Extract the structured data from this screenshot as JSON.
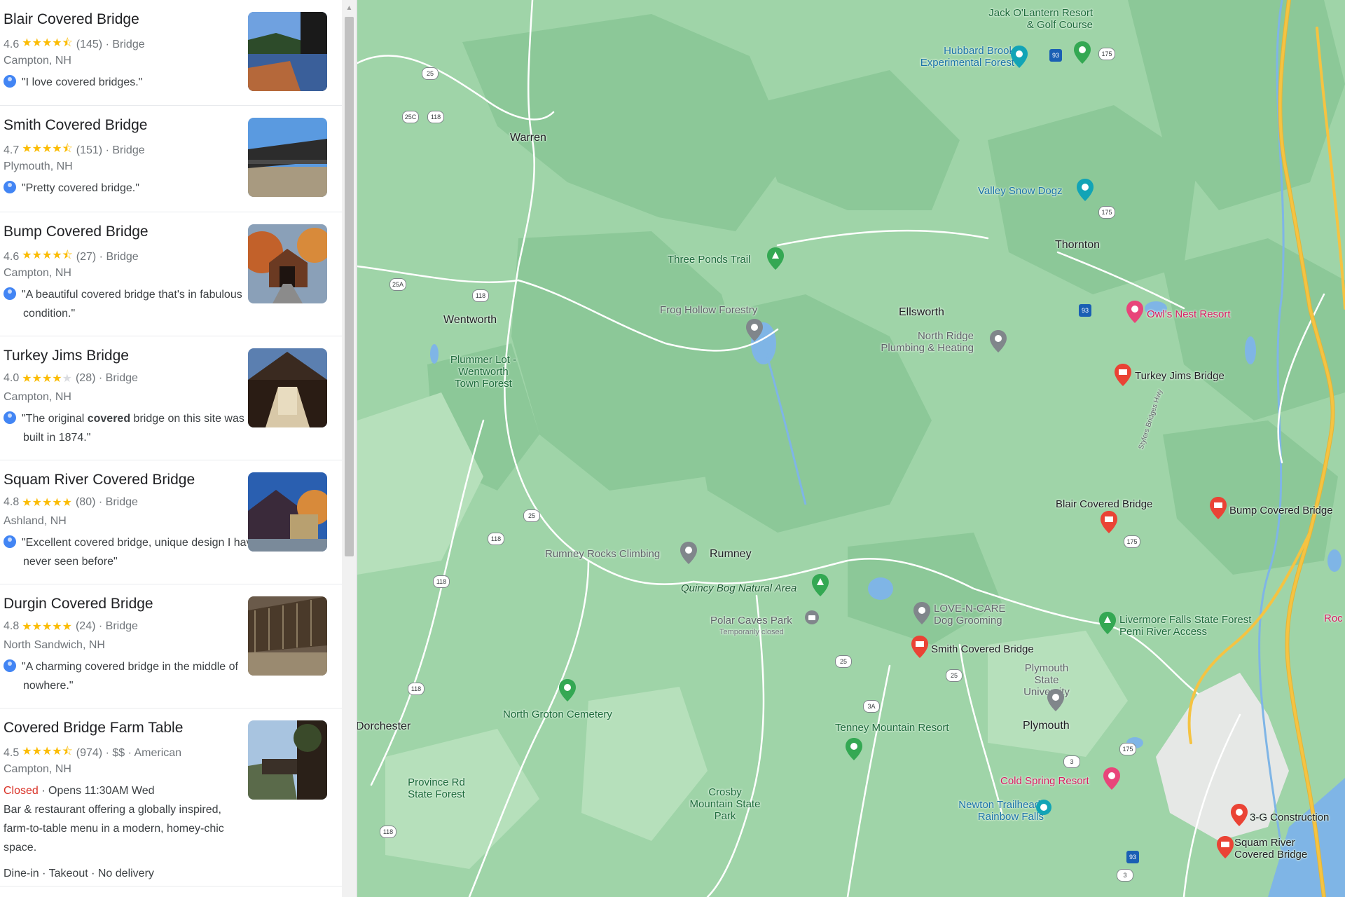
{
  "results": [
    {
      "title": "Blair Covered Bridge",
      "rating": "4.6",
      "stars": 4.5,
      "count": "(145)",
      "type": "Bridge",
      "address": "Campton, NH",
      "review": "\"I love covered bridges.\""
    },
    {
      "title": "Smith Covered Bridge",
      "rating": "4.7",
      "stars": 4.5,
      "count": "(151)",
      "type": "Bridge",
      "address": "Plymouth, NH",
      "review": "\"Pretty covered bridge.\""
    },
    {
      "title": "Bump Covered Bridge",
      "rating": "4.6",
      "stars": 4.5,
      "count": "(27)",
      "type": "Bridge",
      "address": "Campton, NH",
      "review": "\"A beautiful covered bridge that's in fabulous condition.\""
    },
    {
      "title": "Turkey Jims Bridge",
      "rating": "4.0",
      "stars": 4,
      "count": "(28)",
      "type": "Bridge",
      "address": "Campton, NH",
      "review_pre": "\"The original ",
      "review_bold": "covered",
      "review_post": " bridge on this site was built in 1874.\""
    },
    {
      "title": "Squam River Covered Bridge",
      "rating": "4.8",
      "stars": 5,
      "count": "(80)",
      "type": "Bridge",
      "address": "Ashland, NH",
      "review": "\"Excellent covered bridge, unique design I have never seen before\""
    },
    {
      "title": "Durgin Covered Bridge",
      "rating": "4.8",
      "stars": 5,
      "count": "(24)",
      "type": "Bridge",
      "address": "North Sandwich, NH",
      "review": "\"A charming covered bridge in the middle of nowhere.\""
    },
    {
      "title": "Covered Bridge Farm Table",
      "rating": "4.5",
      "stars": 4.5,
      "count": "(974)",
      "type": "$$ · American",
      "address": "Campton, NH",
      "status": "Closed",
      "hours": " · Opens 11:30AM Wed",
      "description": "Bar & restaurant offering a globally inspired, farm-to-table menu in a modern, homey-chic space.",
      "services": "Dine-in · Takeout · No delivery"
    }
  ],
  "map": {
    "towns": {
      "warren": "Warren",
      "wentworth": "Wentworth",
      "rumney": "Rumney",
      "ellsworth": "Ellsworth",
      "thornton": "Thornton",
      "plymouth": "Plymouth",
      "dorchester": "Dorchester"
    },
    "places": {
      "jack_lantern": "Jack O'Lantern Resort & Golf Course",
      "hubbard_brook": "Hubbard Brook Experimental Forest",
      "valley_snow": "Valley Snow Dogz",
      "three_ponds": "Three Ponds Trail",
      "frog_hollow": "Frog Hollow Forestry",
      "north_ridge": "North Ridge Plumbing & Heating",
      "owls_nest": "Owl's Nest Resort",
      "turkey_jims": "Turkey Jims Bridge",
      "plummer": "Plummer Lot - Wentworth Town Forest",
      "blair": "Blair Covered Bridge",
      "bump": "Bump Covered Bridge",
      "rumney_rocks": "Rumney Rocks Climbing",
      "quincy_bog": "Quincy Bog Natural Area",
      "polar_caves": "Polar Caves Park",
      "temp_closed": "Temporarily closed",
      "love_n_care": "LOVE-N-CARE Dog Grooming",
      "smith": "Smith Covered Bridge",
      "livermore": "Livermore Falls State Forest Pemi River Access",
      "psu": "Plymouth State University",
      "north_groton": "North Groton Cemetery",
      "tenney": "Tenney Mountain Resort",
      "cold_spring": "Cold Spring Resort",
      "province_rd": "Province Rd State Forest",
      "crosby": "Crosby Mountain State Park",
      "newton": "Newton Trailhead- Rainbow Falls",
      "three_g": "3-G Construction",
      "squam": "Squam River Covered Bridge",
      "roc": "Roc",
      "sbh": "Stylers Bridges Hwy"
    },
    "routes": [
      "25",
      "25C",
      "118",
      "175",
      "93",
      "25A",
      "3",
      "3A"
    ]
  },
  "colors": {
    "star": "#fbbc04",
    "closed": "#d93025",
    "map_green": "#9fd4a8",
    "pin_red": "#ea4335",
    "pin_green": "#34a853",
    "pin_gray": "#70757a",
    "pin_pink": "#e8457a",
    "pin_teal": "#12a4b6",
    "highway": "#f5c342"
  }
}
